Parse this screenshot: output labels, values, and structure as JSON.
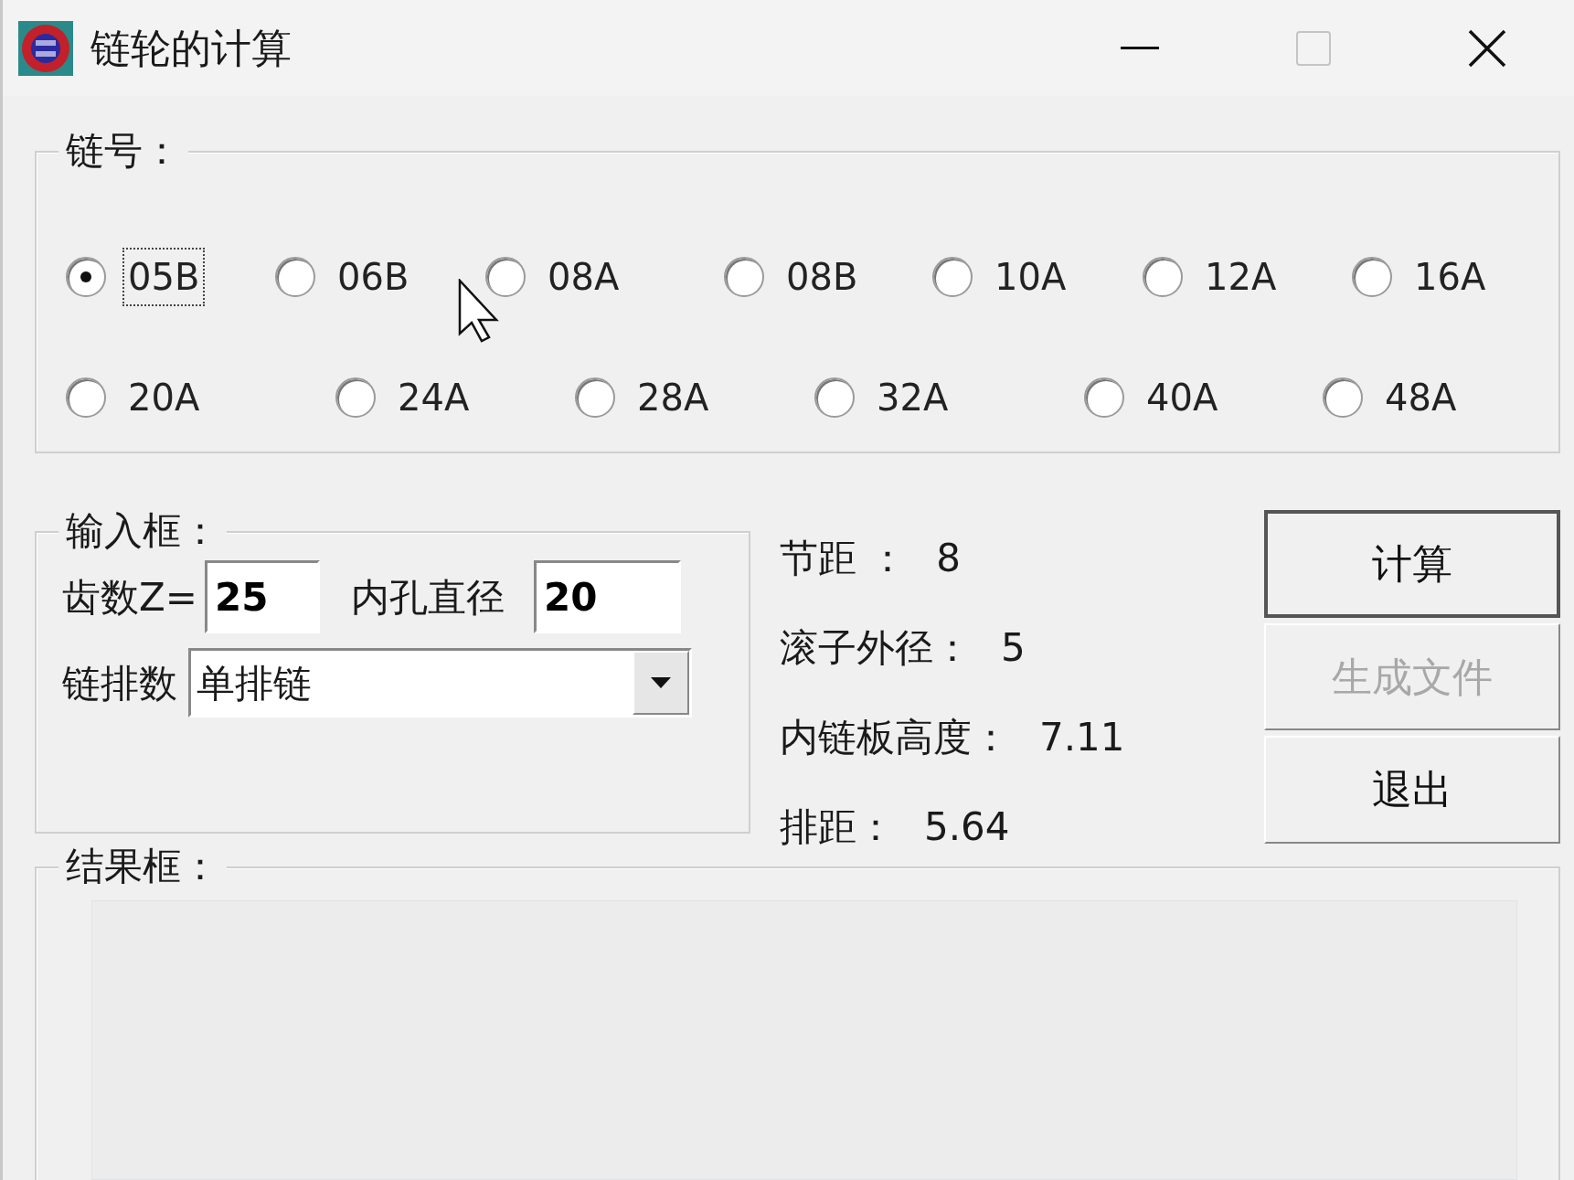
{
  "window": {
    "title": "链轮的计算"
  },
  "chain_group": {
    "title": "链号：",
    "rows": [
      [
        {
          "label": "05B",
          "selected": true,
          "focused": true
        },
        {
          "label": "06B",
          "selected": false,
          "focused": false
        },
        {
          "label": "08A",
          "selected": false,
          "focused": false
        },
        {
          "label": "08B",
          "selected": false,
          "focused": false
        },
        {
          "label": "10A",
          "selected": false,
          "focused": false
        },
        {
          "label": "12A",
          "selected": false,
          "focused": false
        },
        {
          "label": "16A",
          "selected": false,
          "focused": false
        }
      ],
      [
        {
          "label": "20A",
          "selected": false,
          "focused": false
        },
        {
          "label": "24A",
          "selected": false,
          "focused": false
        },
        {
          "label": "28A",
          "selected": false,
          "focused": false
        },
        {
          "label": "32A",
          "selected": false,
          "focused": false
        },
        {
          "label": "40A",
          "selected": false,
          "focused": false
        },
        {
          "label": "48A",
          "selected": false,
          "focused": false
        }
      ]
    ]
  },
  "input_group": {
    "title": "输入框：",
    "teeth": {
      "label": "齿数Z=",
      "value": "25"
    },
    "bore": {
      "label": "内孔直径",
      "value": "20"
    },
    "chain_rows": {
      "label": "链排数",
      "value": "单排链"
    }
  },
  "results": [
    {
      "label": "节距 ：",
      "value": "8"
    },
    {
      "label": "滚子外径：",
      "value": "5"
    },
    {
      "label": "内链板高度：",
      "value": "7.11"
    },
    {
      "label": "排距：",
      "value": "5.64"
    }
  ],
  "buttons": [
    {
      "label": "计算",
      "disabled": false,
      "default": true
    },
    {
      "label": "生成文件",
      "disabled": true,
      "default": false
    },
    {
      "label": "退出",
      "disabled": false,
      "default": false
    }
  ],
  "result_group": {
    "title": "结果框："
  }
}
